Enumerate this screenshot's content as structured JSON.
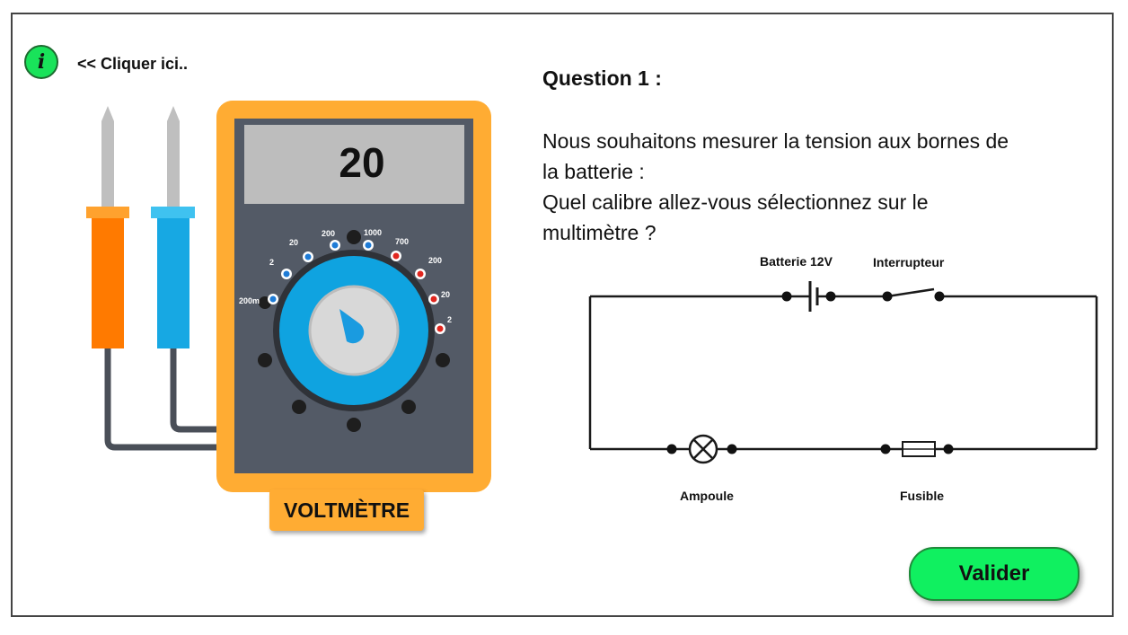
{
  "info": {
    "icon": "info-icon",
    "glyph": "i",
    "label": "<< Cliquer ici.."
  },
  "multimeter": {
    "display_value": "20",
    "name_label": "VOLTMÈTRE",
    "dc_ranges": [
      "200m",
      "2",
      "20",
      "200",
      "1000"
    ],
    "ac_ranges": [
      "700",
      "200",
      "20",
      "2"
    ],
    "colors": {
      "body": "#ffac33",
      "panel": "#535a66",
      "screen": "#bdbdbd",
      "dial": "#0fa3e0",
      "red_probe": "#ff7a00",
      "black_probe": "#17a8e3"
    }
  },
  "question": {
    "title": "Question 1 :",
    "lines": [
      "Nous souhaitons mesurer la tension aux bornes de",
      "la batterie :",
      "Quel calibre allez-vous sélectionnez sur le",
      "multimètre ?"
    ]
  },
  "circuit": {
    "battery_label": "Batterie 12V",
    "switch_label": "Interrupteur",
    "lamp_label": "Ampoule",
    "fuse_label": "Fusible"
  },
  "validate_button": {
    "label": "Valider",
    "color": "#10f060"
  }
}
